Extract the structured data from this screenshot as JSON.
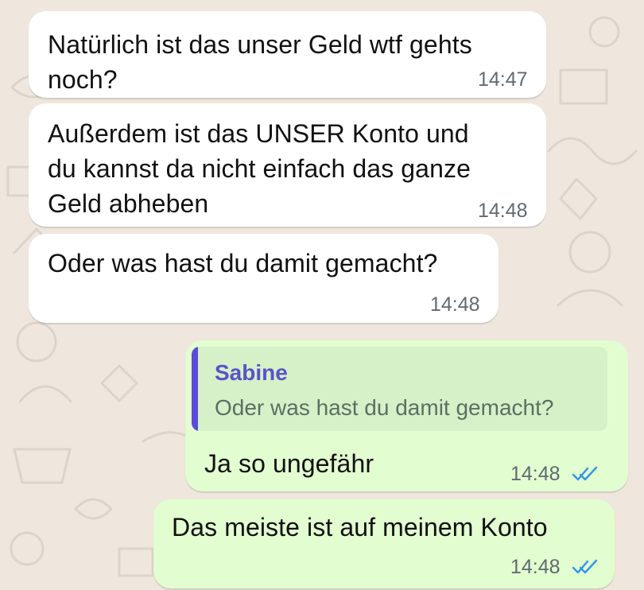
{
  "theme": {
    "background": "#efe7de",
    "incoming_bubble": "#ffffff",
    "outgoing_bubble": "#e2fdcf",
    "read_tick_color": "#2f96e8"
  },
  "messages": [
    {
      "direction": "incoming",
      "text_lines": [
        "Natürlich ist das unser Geld wtf gehts",
        "noch?"
      ],
      "time": "14:47"
    },
    {
      "direction": "incoming",
      "text_lines": [
        "Außerdem ist das UNSER Konto und",
        "du kannst da nicht einfach das ganze",
        "Geld abheben"
      ],
      "time": "14:48"
    },
    {
      "direction": "incoming",
      "text_lines": [
        "Oder was hast du damit gemacht?"
      ],
      "time": "14:48"
    },
    {
      "direction": "outgoing",
      "quote": {
        "author": "Sabine",
        "text": "Oder was hast du damit gemacht?"
      },
      "text_lines": [
        "Ja so ungefähr"
      ],
      "time": "14:48",
      "status_icon": "double-check-read-icon"
    },
    {
      "direction": "outgoing",
      "text_lines": [
        "Das meiste ist auf meinem Konto"
      ],
      "time": "14:48",
      "status_icon": "double-check-read-icon"
    }
  ]
}
